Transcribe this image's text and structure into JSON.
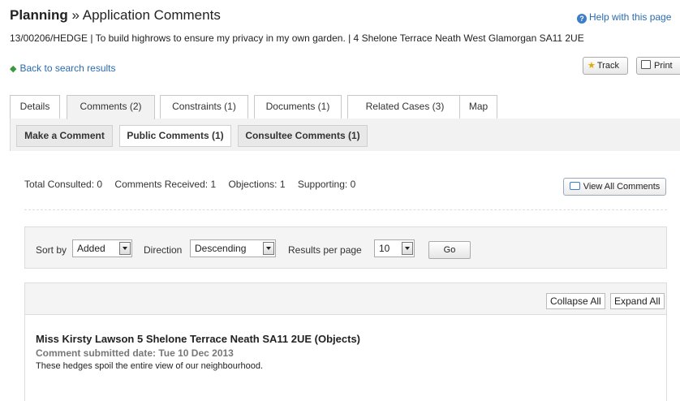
{
  "header": {
    "title_bold": "Planning",
    "title_rest": " » Application Comments",
    "help_link": "Help with this page",
    "description": "13/00206/HEDGE | To build highrows to ensure my privacy in my own garden. | 4 Shelone Terrace Neath West Glamorgan SA11 2UE",
    "back_link": "Back to search results",
    "track_label": "Track",
    "print_label": "Print"
  },
  "tabs": [
    {
      "label": "Details"
    },
    {
      "label": "Comments (2)",
      "active": true
    },
    {
      "label": "Constraints (1)"
    },
    {
      "label": "Documents (1)"
    },
    {
      "label": "Related Cases (3)"
    },
    {
      "label": "Map"
    }
  ],
  "subtabs": [
    {
      "label": "Make a Comment"
    },
    {
      "label": "Public Comments (1)",
      "active": true
    },
    {
      "label": "Consultee Comments (1)"
    }
  ],
  "stats": {
    "total_consulted": "Total Consulted: 0",
    "comments_received": "Comments Received: 1",
    "objections": "Objections: 1",
    "supporting": "Supporting: 0",
    "view_all": "View All Comments"
  },
  "sort": {
    "sort_by_label": "Sort by",
    "sort_by_value": "Added",
    "direction_label": "Direction",
    "direction_value": "Descending",
    "results_label": "Results per page",
    "results_value": "10",
    "go_label": "Go"
  },
  "comments": {
    "collapse_all": "Collapse All",
    "expand_all": "Expand All",
    "items": [
      {
        "name": "Miss Kirsty Lawson 5 Shelone Terrace Neath SA11 2UE (Objects)",
        "date": "Comment submitted date: Tue 10 Dec 2013",
        "text": "These hedges spoil the entire view of our neighbourhood."
      }
    ]
  },
  "colors": {
    "link": "#2a6bb0",
    "panel_bg": "#f2f2f2",
    "border": "#c8c8c8"
  }
}
